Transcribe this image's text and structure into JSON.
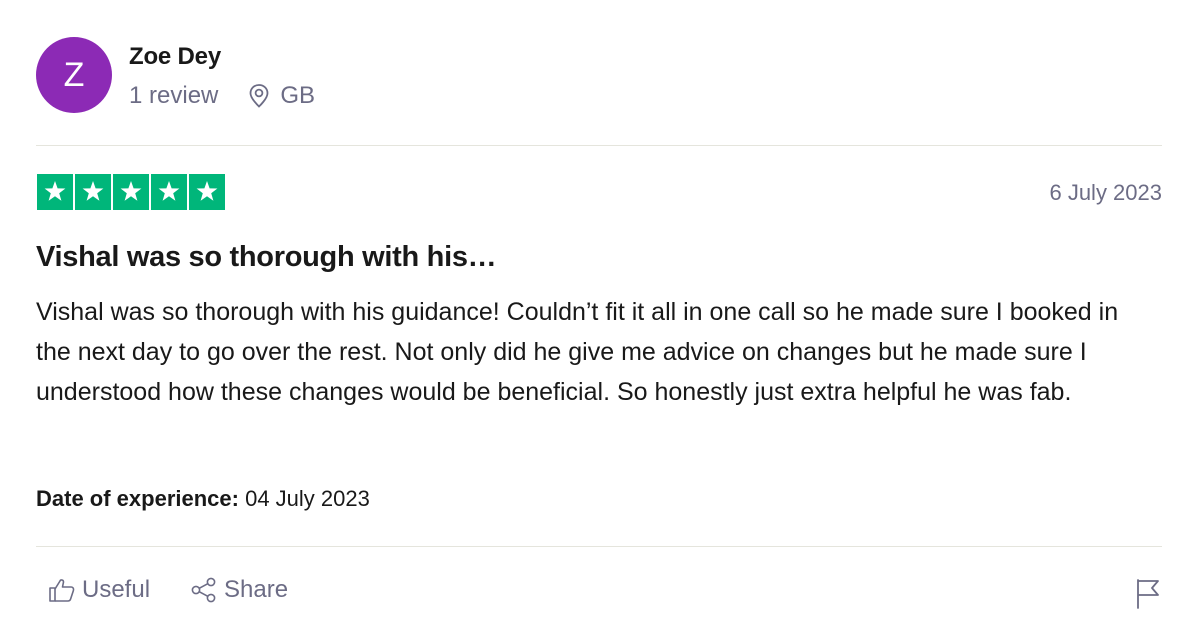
{
  "colors": {
    "avatar_bg": "#8c2ab5",
    "star_green": "#00b67a",
    "muted_text": "#6c6c85"
  },
  "reviewer": {
    "initial": "Z",
    "name": "Zoe Dey",
    "review_count": "1 review",
    "location": "GB",
    "location_icon": "map-pin-icon"
  },
  "review": {
    "rating": 5,
    "date": "6 July 2023",
    "title": "Vishal was so thorough with his…",
    "body": "Vishal was so thorough with his guidance! Couldn’t fit it all in one call so he made sure I booked in the next day to go over the rest. Not only did he give me advice on changes but he made sure I understood how these changes would be beneficial. So honestly just extra helpful he was fab.",
    "experience_label": "Date of experience:",
    "experience_date": "04 July 2023"
  },
  "actions": {
    "useful_label": "Useful",
    "useful_icon": "thumbs-up-icon",
    "share_label": "Share",
    "share_icon": "share-icon",
    "report_icon": "flag-icon"
  }
}
